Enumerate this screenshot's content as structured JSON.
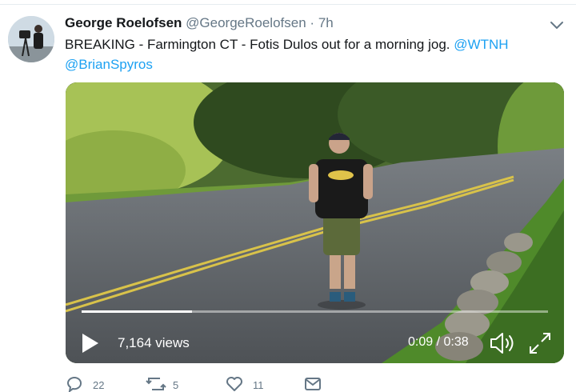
{
  "tweet": {
    "author_name": "George Roelofsen",
    "author_handle": "@GeorgeRoelofsen",
    "separator": "·",
    "timestamp": "7h",
    "text": "BREAKING - Farmington CT - Fotis Dulos out for a morning jog.",
    "mentions": [
      "@WTNH",
      "@BrianSpyros"
    ]
  },
  "video": {
    "views": "7,164 views",
    "current_time": "0:09",
    "duration": "0:38",
    "time_display": "0:09 / 0:38",
    "progress_fraction": 0.237
  },
  "actions": {
    "reply_count": "22",
    "retweet_count": "5",
    "like_count": "11"
  },
  "icons": [
    "caret-down-icon",
    "play-icon",
    "volume-icon",
    "fullscreen-icon",
    "reply-icon",
    "retweet-icon",
    "like-icon",
    "message-icon"
  ],
  "colors": {
    "link": "#1da1f2",
    "secondary_text": "#657786",
    "primary_text": "#14171a"
  }
}
